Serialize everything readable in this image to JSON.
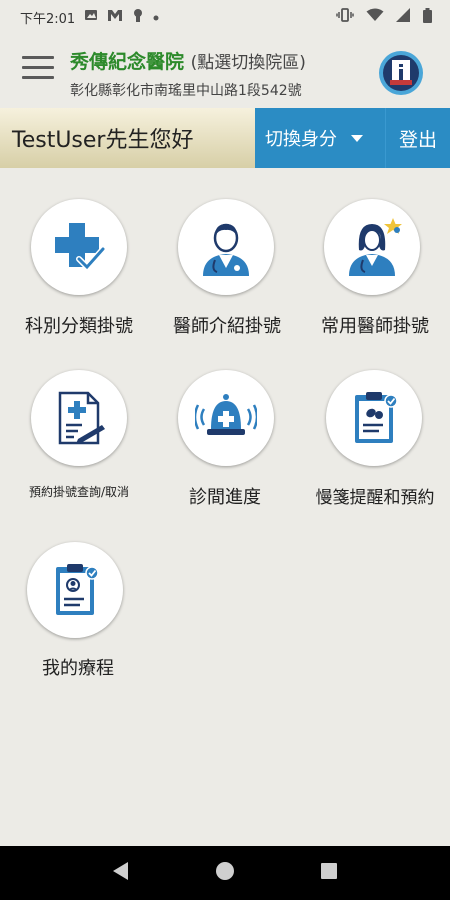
{
  "status_bar": {
    "time": "下午2:01",
    "icons": [
      "photo-icon",
      "mail-icon",
      "keyhole-icon",
      "dot-icon",
      "vibrate-icon",
      "wifi-icon",
      "signal-icon",
      "battery-icon"
    ]
  },
  "header": {
    "hospital_name": "秀傳紀念醫院",
    "switch_hint": "(點選切換院區)",
    "address": "彰化縣彰化市南瑤里中山路1段542號"
  },
  "user_bar": {
    "greeting": "TestUser先生您好",
    "switch_identity": "切換身分",
    "logout": "登出"
  },
  "menu": [
    {
      "label": "科別分類掛號",
      "icon": "medical-cross-check-icon"
    },
    {
      "label": "醫師介紹掛號",
      "icon": "male-doctor-icon"
    },
    {
      "label": "常用醫師掛號",
      "icon": "female-doctor-star-icon"
    },
    {
      "label": "預約掛號查詢/取消",
      "icon": "document-pen-icon"
    },
    {
      "label": "診間進度",
      "icon": "alarm-bell-icon"
    },
    {
      "label": "慢箋提醒和預約",
      "icon": "prescription-clipboard-icon"
    },
    {
      "label": "我的療程",
      "icon": "patient-clipboard-icon"
    }
  ],
  "colors": {
    "green": "#2d8a2b",
    "blue": "#2b8cc4",
    "navy": "#1f3a6b",
    "background": "#ecebe6"
  }
}
